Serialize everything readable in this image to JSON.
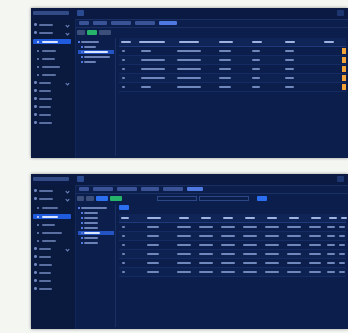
{
  "colors": {
    "page_bg": "#f4f6f2",
    "panel_bg": "#0b1e4c",
    "sidebar_bg": "#0a1a3f",
    "accent_blue": "#1f5bdc",
    "accent_green": "#26b36a",
    "accent_orange": "#f2a33a"
  },
  "icons": [
    "bell-icon",
    "user-icon",
    "chevron-icon"
  ],
  "screen1": {
    "app_title": "",
    "sidebar": {
      "items": [
        {
          "label": ""
        },
        {
          "label": ""
        },
        {
          "label": ""
        },
        {
          "label": ""
        },
        {
          "label": ""
        },
        {
          "label": ""
        },
        {
          "label": ""
        },
        {
          "label": ""
        },
        {
          "label": ""
        },
        {
          "label": ""
        },
        {
          "label": ""
        },
        {
          "label": ""
        },
        {
          "label": ""
        }
      ]
    },
    "tabs": [
      {
        "label": ""
      },
      {
        "label": ""
      },
      {
        "label": ""
      },
      {
        "label": ""
      },
      {
        "label": ""
      }
    ],
    "toolbar": {
      "btn1": "",
      "btn2": "",
      "btn3": ""
    },
    "tree": [
      {
        "label": ""
      },
      {
        "label": ""
      },
      {
        "label": ""
      },
      {
        "label": ""
      },
      {
        "label": ""
      }
    ],
    "table": {
      "headers": [
        "",
        "",
        "",
        "",
        "",
        "",
        ""
      ],
      "rows": [
        [
          "",
          "",
          "",
          "",
          "",
          "",
          ""
        ],
        [
          "",
          "",
          "",
          "",
          "",
          "",
          ""
        ],
        [
          "",
          "",
          "",
          "",
          "",
          "",
          ""
        ],
        [
          "",
          "",
          "",
          "",
          "",
          "",
          ""
        ],
        [
          "",
          "",
          "",
          "",
          "",
          "",
          ""
        ]
      ]
    }
  },
  "screen2": {
    "app_title": "",
    "sidebar": {
      "items": [
        {
          "label": ""
        },
        {
          "label": ""
        },
        {
          "label": ""
        },
        {
          "label": ""
        },
        {
          "label": ""
        },
        {
          "label": ""
        },
        {
          "label": ""
        },
        {
          "label": ""
        },
        {
          "label": ""
        },
        {
          "label": ""
        },
        {
          "label": ""
        },
        {
          "label": ""
        },
        {
          "label": ""
        }
      ]
    },
    "tabs": [
      {
        "label": ""
      },
      {
        "label": ""
      },
      {
        "label": ""
      },
      {
        "label": ""
      },
      {
        "label": ""
      },
      {
        "label": ""
      }
    ],
    "filter": {
      "search_placeholder": "",
      "date_range": "",
      "query_button": "",
      "add_button": "",
      "btn_a": "",
      "btn_b": "",
      "btn_c": ""
    },
    "tree": [
      {
        "label": ""
      },
      {
        "label": ""
      },
      {
        "label": ""
      },
      {
        "label": ""
      },
      {
        "label": ""
      },
      {
        "label": ""
      },
      {
        "label": ""
      },
      {
        "label": ""
      }
    ],
    "table": {
      "headers": [
        "",
        "",
        "",
        "",
        "",
        "",
        "",
        "",
        "",
        "",
        ""
      ],
      "rows": [
        [
          "",
          "",
          "",
          "",
          "",
          "",
          "",
          "",
          "",
          "",
          ""
        ],
        [
          "",
          "",
          "",
          "",
          "",
          "",
          "",
          "",
          "",
          "",
          ""
        ],
        [
          "",
          "",
          "",
          "",
          "",
          "",
          "",
          "",
          "",
          "",
          ""
        ],
        [
          "",
          "",
          "",
          "",
          "",
          "",
          "",
          "",
          "",
          "",
          ""
        ],
        [
          "",
          "",
          "",
          "",
          "",
          "",
          "",
          "",
          "",
          "",
          ""
        ],
        [
          "",
          "",
          "",
          "",
          "",
          "",
          "",
          "",
          "",
          "",
          ""
        ]
      ]
    }
  }
}
